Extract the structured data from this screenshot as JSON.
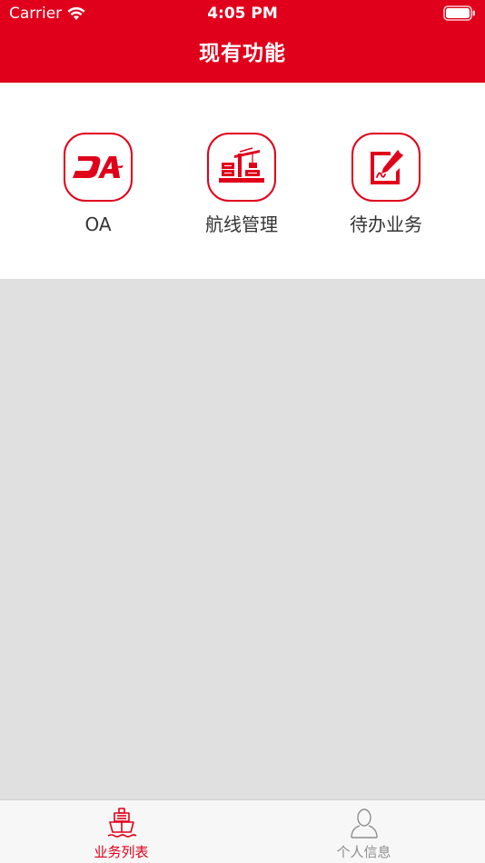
{
  "status_bar": {
    "carrier": "Carrier",
    "time": "4:05 PM",
    "wifi_icon": "wifi-icon",
    "battery_icon": "battery-icon"
  },
  "nav": {
    "title": "现有功能"
  },
  "functions": [
    {
      "label": "OA",
      "icon": "oa-logo-icon"
    },
    {
      "label": "航线管理",
      "icon": "port-crane-icon"
    },
    {
      "label": "待办业务",
      "icon": "sign-document-icon"
    }
  ],
  "tabs": [
    {
      "label": "业务列表",
      "icon": "ship-icon",
      "active": true
    },
    {
      "label": "个人信息",
      "icon": "person-icon",
      "active": false
    }
  ],
  "colors": {
    "brand": "#e0001b",
    "background": "#e0e0e0",
    "panel": "#ffffff",
    "tab_inactive": "#8e8e8e"
  }
}
